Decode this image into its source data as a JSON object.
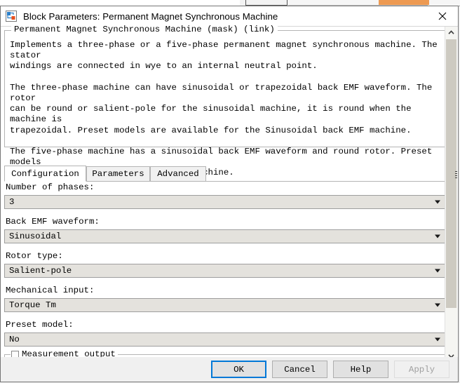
{
  "window": {
    "title": "Block Parameters: Permanent Magnet Synchronous Machine",
    "icon": "simulink-block-icon",
    "close_label": "✕"
  },
  "description": {
    "legend": "Permanent Magnet Synchronous Machine (mask) (link)",
    "body": "Implements a three-phase or a five-phase permanent magnet synchronous machine. The stator\nwindings are connected in wye to an internal neutral point.\n\nThe three-phase machine can have sinusoidal or trapezoidal back EMF waveform. The rotor\ncan be round or salient-pole for the sinusoidal machine, it is round when the machine is\ntrapezoidal. Preset models are available for the Sinusoidal back EMF machine.\n\nThe five-phase machine has a sinusoidal back EMF waveform and round rotor. Preset models\nare not available for this type of machine."
  },
  "tabs": [
    {
      "label": "Configuration",
      "active": true
    },
    {
      "label": "Parameters",
      "active": false
    },
    {
      "label": "Advanced",
      "active": false
    }
  ],
  "fields": [
    {
      "label": "Number of phases:",
      "value": "3"
    },
    {
      "label": "Back EMF waveform:",
      "value": "Sinusoidal"
    },
    {
      "label": "Rotor type:",
      "value": "Salient-pole"
    },
    {
      "label": "Mechanical input:",
      "value": "Torque Tm"
    },
    {
      "label": "Preset model:",
      "value": "No"
    }
  ],
  "measurement_group": {
    "label": "Measurement output",
    "checked": false
  },
  "scrollbars": {
    "vertical_up": "˄",
    "vertical_down": "˅",
    "horizontal_left": "‹",
    "horizontal_right": "›"
  },
  "buttons": [
    {
      "label": "OK",
      "state": "default"
    },
    {
      "label": "Cancel",
      "state": "normal"
    },
    {
      "label": "Help",
      "state": "normal"
    },
    {
      "label": "Apply",
      "state": "disabled"
    }
  ],
  "colors": {
    "accent": "#0078d7",
    "combo_fill": "#e4e2dd",
    "scroll_thumb": "#cdcac1",
    "bg_orange": "#ed9a52"
  }
}
